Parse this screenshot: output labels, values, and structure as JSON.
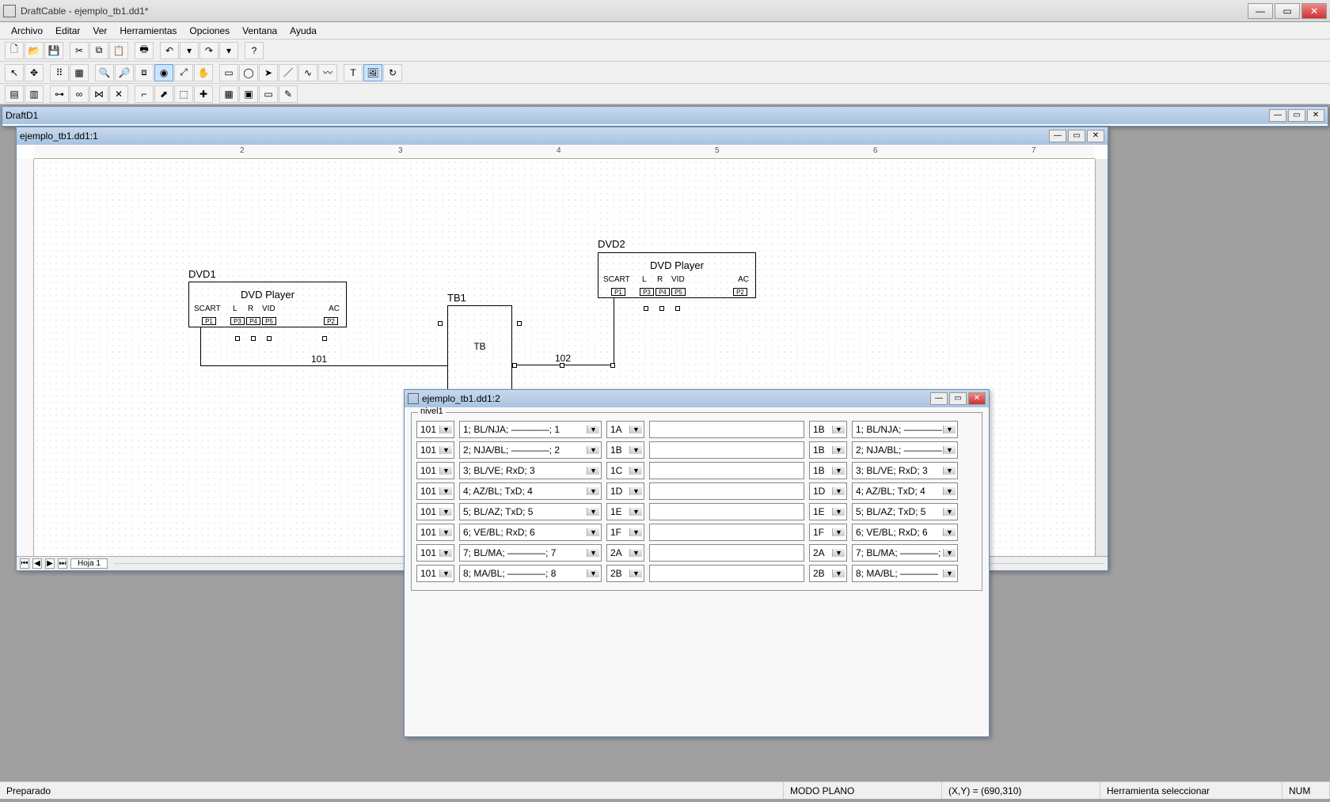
{
  "title": "DraftCable - ejemplo_tb1.dd1*",
  "menu": [
    "Archivo",
    "Editar",
    "Ver",
    "Herramientas",
    "Opciones",
    "Ventana",
    "Ayuda"
  ],
  "mdi_outer_title": "DraftD1",
  "draw_win_title": "ejemplo_tb1.dd1:1",
  "ruler_h": [
    "2",
    "3",
    "4",
    "5",
    "6",
    "7"
  ],
  "schematic": {
    "dvd1": {
      "ref": "DVD1",
      "name": "DVD Player",
      "pins_top": [
        "L",
        "R",
        "VID"
      ],
      "left": "SCART",
      "right": "AC",
      "pins_small": [
        "P1",
        "P3",
        "P4",
        "P5",
        "P2"
      ]
    },
    "dvd2": {
      "ref": "DVD2",
      "name": "DVD Player",
      "pins_top": [
        "L",
        "R",
        "VID"
      ],
      "left": "SCART",
      "right": "AC",
      "pins_small": [
        "P1",
        "P3",
        "P4",
        "P5",
        "P2"
      ]
    },
    "tb1": {
      "ref": "TB1",
      "name": "TB"
    },
    "wire1": "101",
    "wire2": "102"
  },
  "sheet_tab": "Hoja 1",
  "tbl_win_title": "ejemplo_tb1.dd1:2",
  "tbl_group": "nivel1",
  "rows": [
    {
      "a": "101",
      "b": "1; BL/NJA; ————; 1",
      "c": "1A",
      "d": "1B",
      "e": "1; BL/NJA; ————"
    },
    {
      "a": "101",
      "b": "2; NJA/BL; ————; 2",
      "c": "1B",
      "d": "1B",
      "e": "2; NJA/BL; ————"
    },
    {
      "a": "101",
      "b": "3; BL/VE; RxD; 3",
      "c": "1C",
      "d": "1B",
      "e": "3; BL/VE; RxD; 3"
    },
    {
      "a": "101",
      "b": "4; AZ/BL; TxD; 4",
      "c": "1D",
      "d": "1D",
      "e": "4; AZ/BL; TxD; 4"
    },
    {
      "a": "101",
      "b": "5; BL/AZ; TxD; 5",
      "c": "1E",
      "d": "1E",
      "e": "5; BL/AZ; TxD; 5"
    },
    {
      "a": "101",
      "b": "6; VE/BL; RxD; 6",
      "c": "1F",
      "d": "1F",
      "e": "6; VE/BL; RxD; 6"
    },
    {
      "a": "101",
      "b": "7; BL/MA; ————; 7",
      "c": "2A",
      "d": "2A",
      "e": "7; BL/MA; ————;"
    },
    {
      "a": "101",
      "b": "8; MA/BL; ————; 8",
      "c": "2B",
      "d": "2B",
      "e": "8; MA/BL; ————"
    }
  ],
  "status": {
    "ready": "Preparado",
    "mode": "MODO PLANO",
    "xy": "(X,Y) = (690,310)",
    "tool": "Herramienta seleccionar",
    "num": "NUM"
  }
}
